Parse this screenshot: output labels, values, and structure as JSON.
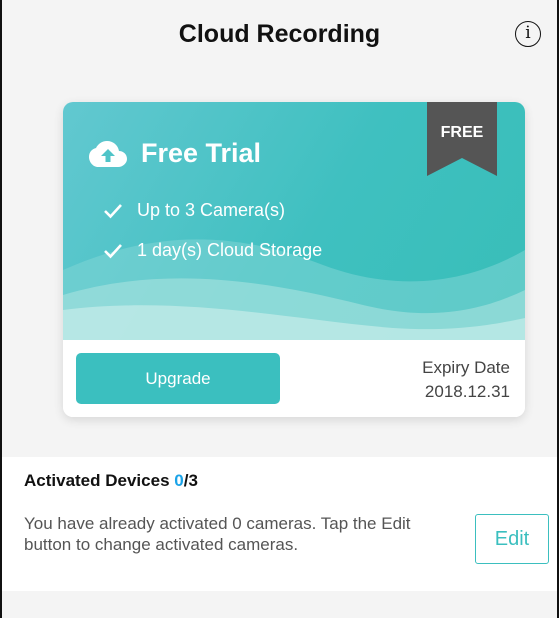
{
  "header": {
    "title": "Cloud Recording",
    "info_icon_glyph": "i"
  },
  "card": {
    "plan_name": "Free Trial",
    "badge": "FREE",
    "features": [
      "Up to 3 Camera(s)",
      "1 day(s) Cloud Storage"
    ],
    "upgrade_label": "Upgrade",
    "expiry_label": "Expiry Date",
    "expiry_value": "2018.12.31",
    "colors": {
      "accent": "#3bbfbf",
      "badge": "#555555"
    }
  },
  "devices": {
    "title": "Activated Devices",
    "active_count": "0",
    "total": "/3",
    "description": "You have already activated 0 cameras. Tap the Edit button to change activated cameras.",
    "edit_label": "Edit",
    "count_color": "#1aa3e8"
  }
}
